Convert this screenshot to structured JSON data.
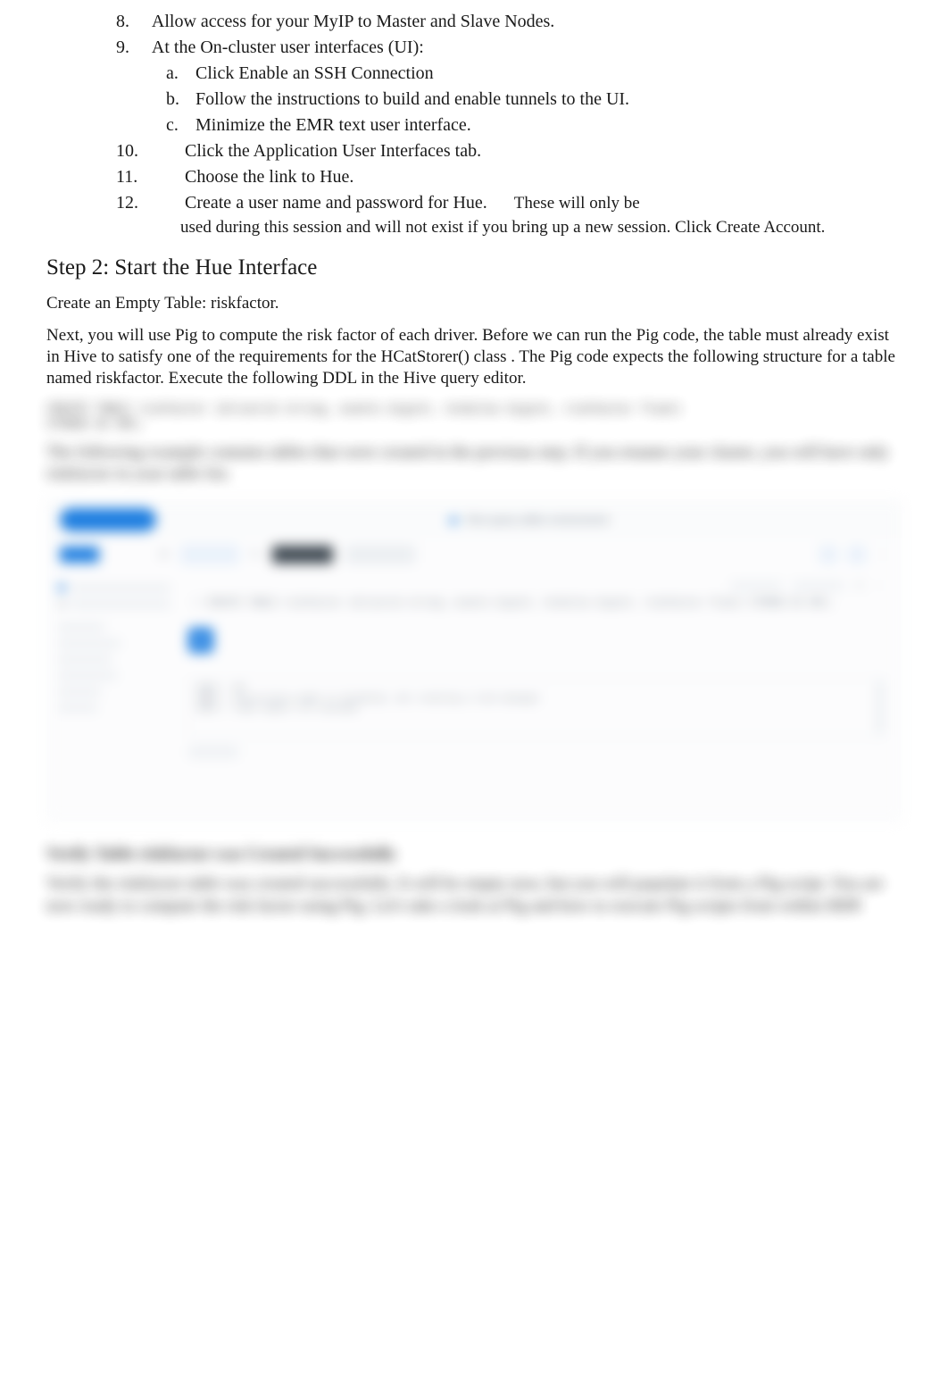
{
  "list": {
    "i8": {
      "num": "8.",
      "text": "Allow access for your MyIP to Master and Slave Nodes."
    },
    "i9": {
      "num": "9.",
      "text": "At the On-cluster user interfaces (UI):"
    },
    "i9a": {
      "num": "a.",
      "text": "Click Enable an SSH Connection"
    },
    "i9b": {
      "num": "b.",
      "text": "Follow the instructions to build and enable tunnels to the UI."
    },
    "i9c": {
      "num": "c.",
      "text": "Minimize the EMR text user interface."
    },
    "i10": {
      "num": "10.",
      "text": "Click the Application User Interfaces tab."
    },
    "i11": {
      "num": "11.",
      "text": "Choose the link to Hue."
    },
    "i12": {
      "num": "12.",
      "text": "Create a user name and password for Hue.",
      "tail": "These will only be",
      "cont": "used during this session and will not exist if you bring up a new session. Click Create Account."
    }
  },
  "step2_heading": "Step 2: Start the Hue Interface",
  "create_table": "Create an Empty Table: riskfactor.",
  "intro": "Next, you will use Pig to compute the risk factor of each driver. Before we can run the Pig code, the table must already exist in Hive to satisfy one of the requirements for the HCatStorer() class . The Pig code expects the following structure for a table named riskfactor. Execute the following DDL in the Hive query editor.",
  "blur": {
    "code1": "CREATE TABLE riskfactor (driverid string, events bigint, totmiles bigint, riskfactor float)",
    "code2": "STORED AS ORC;",
    "para1": "The following example contains tables that were created in the previous step. If you rename your cluster, you will have only riskfactor in your table list.",
    "ui": {
      "tab_hint": "Hive query editor environment",
      "default": "default",
      "add_new": "Add a new...",
      "db_label": "Database  default",
      "type_label": "Type  hive",
      "editor_line": "CREATE TABLE riskfactor (driverid string, events bigint, totmiles bigint, riskfactor float) STORED AS ORC;",
      "info1": "INFO  : OK",
      "info2": "INFO  : Concurrency mode is disabled, not creating a lock manager",
      "info3": "INFO  : Time taken: 0.5 seconds",
      "results": "Results"
    },
    "h3": "Verify Table riskfactor was Created Successfully",
    "para2": "Verify the riskfactor table was created successfully. It will be empty now, but you will populate it from a Pig script. You are now ready to compute the risk factor using Pig. Let's take a look at Pig and how to execute Pig scripts from within HDP."
  }
}
